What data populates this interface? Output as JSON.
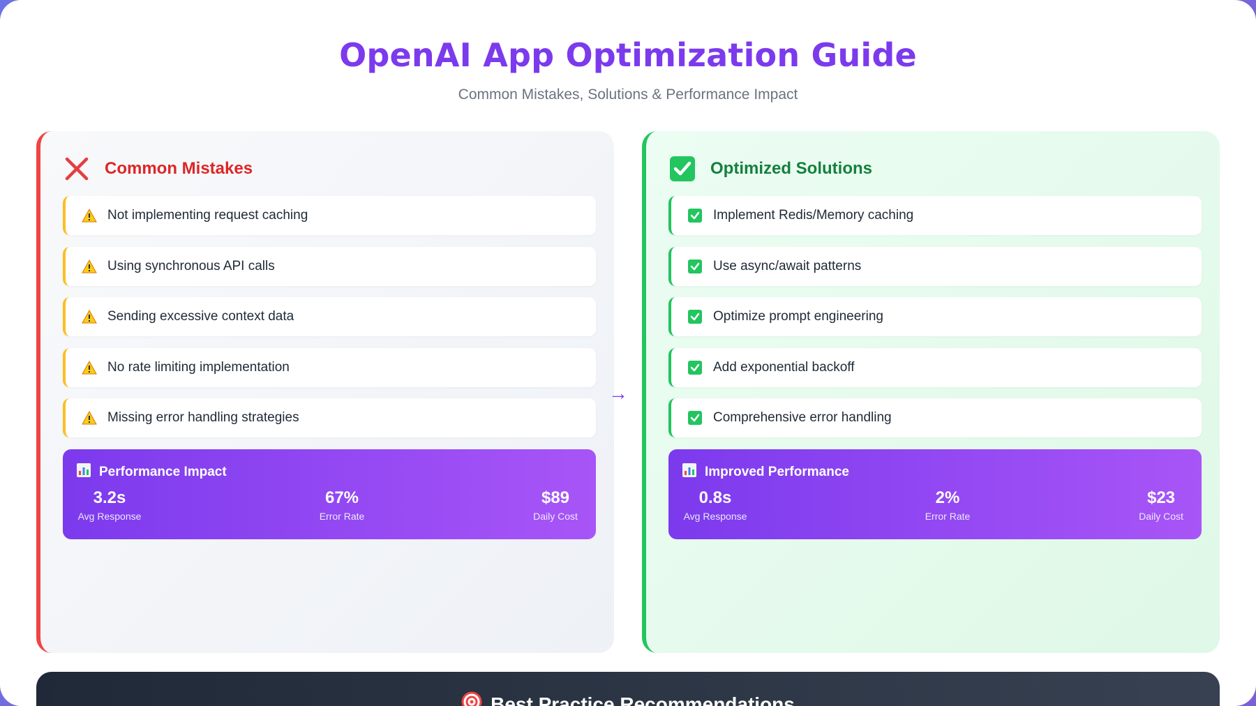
{
  "header": {
    "title": "OpenAI App Optimization Guide",
    "subtitle": "Common Mistakes, Solutions & Performance Impact"
  },
  "mistakes": {
    "heading": "Common Mistakes",
    "icon": "x-icon",
    "items": [
      "Not implementing request caching",
      "Using synchronous API calls",
      "Sending excessive context data",
      "No rate limiting implementation",
      "Missing error handling strategies"
    ],
    "performance": {
      "title": "Performance Impact",
      "metrics": [
        {
          "value": "3.2s",
          "label": "Avg Response"
        },
        {
          "value": "67%",
          "label": "Error Rate"
        },
        {
          "value": "$89",
          "label": "Daily Cost"
        }
      ]
    }
  },
  "solutions": {
    "heading": "Optimized Solutions",
    "icon": "check-box-icon",
    "items": [
      "Implement Redis/Memory caching",
      "Use async/await patterns",
      "Optimize prompt engineering",
      "Add exponential backoff",
      "Comprehensive error handling"
    ],
    "performance": {
      "title": "Improved Performance",
      "metrics": [
        {
          "value": "0.8s",
          "label": "Avg Response"
        },
        {
          "value": "2%",
          "label": "Error Rate"
        },
        {
          "value": "$23",
          "label": "Daily Cost"
        }
      ]
    }
  },
  "arrow": "→",
  "footer": {
    "title": "Best Practice Recommendations",
    "icon": "target-icon"
  },
  "colors": {
    "accent": "#7c3aed",
    "mistake": "#dc2626",
    "solution": "#15803d",
    "warning": "#fbbf24"
  }
}
